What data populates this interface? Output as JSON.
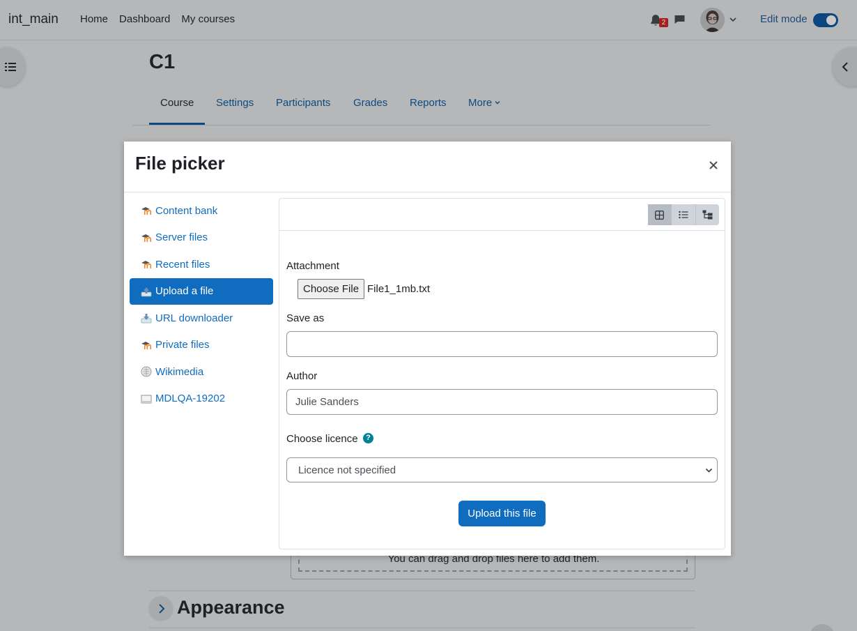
{
  "navbar": {
    "brand": "int_main",
    "links": [
      "Home",
      "Dashboard",
      "My courses"
    ],
    "notification_count": "2",
    "edit_mode_label": "Edit mode"
  },
  "course": {
    "title": "C1",
    "tabs": [
      "Course",
      "Settings",
      "Participants",
      "Grades",
      "Reports",
      "More"
    ]
  },
  "background": {
    "dropzone_text": "You can drag and drop files here to add them.",
    "section_title": "Appearance"
  },
  "modal": {
    "title": "File picker",
    "repositories": [
      {
        "label": "Content bank",
        "icon": "moodle-icon"
      },
      {
        "label": "Server files",
        "icon": "moodle-icon"
      },
      {
        "label": "Recent files",
        "icon": "moodle-icon"
      },
      {
        "label": "Upload a file",
        "icon": "upload-icon"
      },
      {
        "label": "URL downloader",
        "icon": "url-download-icon"
      },
      {
        "label": "Private files",
        "icon": "moodle-icon"
      },
      {
        "label": "Wikimedia",
        "icon": "wikimedia-icon"
      },
      {
        "label": "MDLQA-19202",
        "icon": "drive-icon"
      }
    ],
    "active_repository": "Upload a file",
    "form": {
      "attachment_label": "Attachment",
      "choose_file_label": "Choose File",
      "file_name": "File1_1mb.txt",
      "save_as_label": "Save as",
      "save_as_value": "",
      "author_label": "Author",
      "author_value": "Julie Sanders",
      "licence_label": "Choose licence",
      "licence_value": "Licence not specified",
      "upload_button": "Upload this file"
    }
  },
  "colors": {
    "primary": "#0f6cbf",
    "help": "#008196",
    "badge": "#a51f1f"
  }
}
